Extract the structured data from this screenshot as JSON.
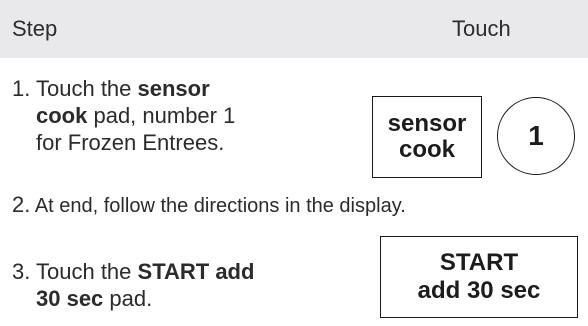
{
  "header": {
    "step_label": "Step",
    "touch_label": "Touch"
  },
  "step1": {
    "number": "1.",
    "line1_text": "Touch the ",
    "line1_bold": "sensor",
    "line2_bold": "cook",
    "line2_text": " pad, number 1",
    "line3_text": "for Frozen Entrees."
  },
  "step2": {
    "number": "2.",
    "text": " At end, follow the directions in the display."
  },
  "step3": {
    "number": "3.",
    "line1_text": "Touch the ",
    "line1_bold": "START add",
    "line2_bold": "30 sec",
    "line2_text": " pad."
  },
  "pads": {
    "sensor_line1": "sensor",
    "sensor_line2": "cook",
    "number_one": "1",
    "start_line1": "START",
    "start_line2": "add 30 sec"
  }
}
